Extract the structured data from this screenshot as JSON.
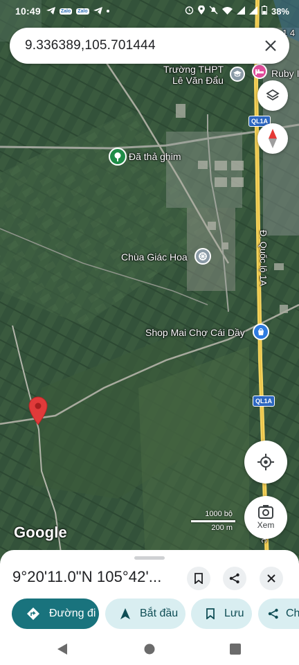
{
  "status_bar": {
    "time": "10:49",
    "notif_zalo_1": "Zalo",
    "notif_zalo_2": "Zalo",
    "battery": "38%"
  },
  "search": {
    "query": "9.336389,105.701444"
  },
  "map": {
    "labels": {
      "school_line1": "Trường THPT",
      "school_line2": "Lê Văn Đẩu",
      "hotel": "Ruby I",
      "pin_dropped": "Đã thả ghim",
      "pagoda": "Chùa Giác Hoa",
      "shop": "Shop Mai Chợ Cái Dầy",
      "road_ql1a": "Đ. Quốc lộ 1A",
      "top_right_number": "1 4",
      "right_edge_chars": "ốc"
    },
    "road_shields": [
      "QL1A",
      "QL1A"
    ],
    "logo": "Google",
    "scale": {
      "top": "1000 bộ",
      "bottom": "200 m"
    }
  },
  "fab": {
    "explore_label": "Xem"
  },
  "sheet": {
    "coords": "9°20'11.0\"N 105°42'..."
  },
  "chips": {
    "directions": "Đường đi",
    "start": "Bắt đầu",
    "save": "Lưu",
    "share": "Ch"
  },
  "colors": {
    "accent": "#19737d",
    "chip_secondary": "#d9eef1",
    "pin_red": "#e03a3a",
    "road_yellow": "#f4d35e"
  }
}
